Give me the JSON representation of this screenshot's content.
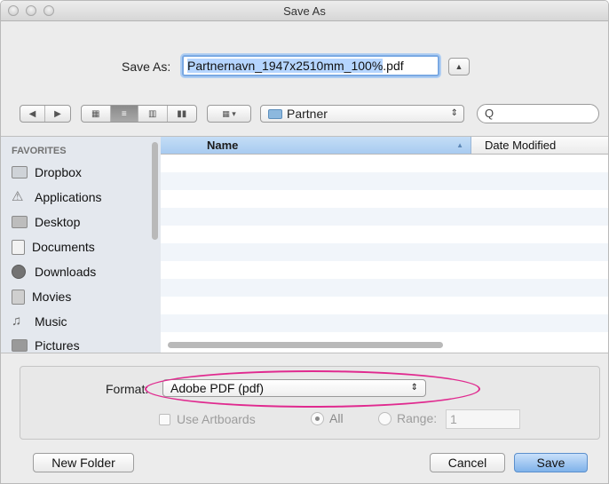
{
  "window": {
    "title": "Save As"
  },
  "saveas": {
    "label": "Save As:",
    "filename_base": "Partnernavn_1947x2510mm_100%",
    "filename_ext": ".pdf",
    "expand_icon": "triangle-up-icon"
  },
  "toolbar": {
    "back_icon": "◀",
    "forward_icon": "▶",
    "path_folder": "Partner",
    "path_arrows": "⇕",
    "search_icon": "Q"
  },
  "sidebar": {
    "header": "FAVORITES",
    "items": [
      {
        "label": "Dropbox",
        "icon": "folder-icon"
      },
      {
        "label": "Applications",
        "icon": "applications-icon"
      },
      {
        "label": "Desktop",
        "icon": "desktop-icon"
      },
      {
        "label": "Documents",
        "icon": "documents-icon"
      },
      {
        "label": "Downloads",
        "icon": "downloads-icon"
      },
      {
        "label": "Movies",
        "icon": "movies-icon"
      },
      {
        "label": "Music",
        "icon": "music-icon"
      },
      {
        "label": "Pictures",
        "icon": "camera-icon"
      }
    ]
  },
  "filelist": {
    "columns": [
      "Name",
      "Date Modified"
    ],
    "sorted_column": "Name"
  },
  "options": {
    "format_label": "Format:",
    "format_value": "Adobe PDF (pdf)",
    "use_artboards_label": "Use Artboards",
    "all_label": "All",
    "range_label": "Range:",
    "range_value": "1",
    "highlight_color": "#e02a8f"
  },
  "buttons": {
    "new_folder": "New Folder",
    "cancel": "Cancel",
    "save": "Save"
  }
}
